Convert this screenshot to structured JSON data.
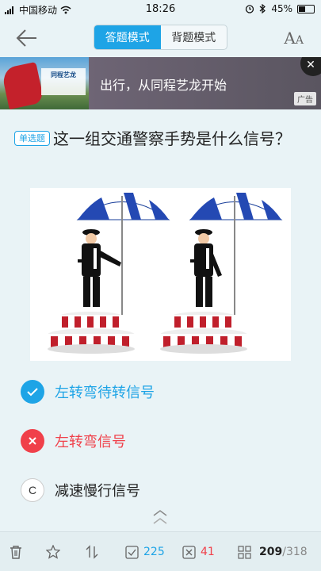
{
  "status_bar": {
    "carrier": "中国移动",
    "time": "18:26",
    "battery": "45%"
  },
  "nav": {
    "mode_answer": "答题模式",
    "mode_recite": "背题模式",
    "font_label": "AA"
  },
  "ad": {
    "title": "出行，从同程艺龙开始",
    "tag": "广告"
  },
  "question": {
    "type_tag": "单选题",
    "text": "这一组交通警察手势是什么信号？"
  },
  "options": [
    {
      "marker": "check-icon",
      "text": "左转弯待转信号",
      "state": "correct"
    },
    {
      "marker": "x-icon",
      "text": "左转弯信号",
      "state": "wrong"
    },
    {
      "marker": "C",
      "text": "减速慢行信号",
      "state": "plain"
    }
  ],
  "bottom_bar": {
    "correct_count": "225",
    "wrong_count": "41",
    "current": "209",
    "total": "/318"
  },
  "colors": {
    "accent": "#1ea4e6",
    "wrong": "#f0404a",
    "background": "#e9f3f6"
  }
}
